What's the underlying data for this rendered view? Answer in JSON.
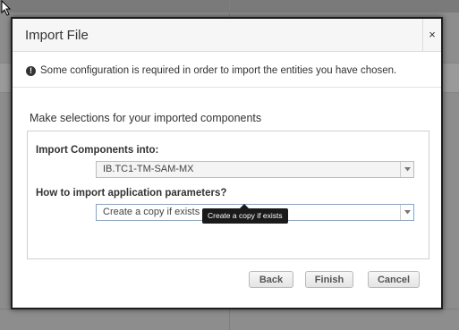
{
  "dialog": {
    "title": "Import File",
    "close_label": "×",
    "info_icon": "!",
    "info_text": "Some configuration is required in order to import the entities you have chosen.",
    "section_title": "Make selections for your imported components",
    "fields": {
      "components_label": "Import Components into:",
      "components_value": "IB.TC1-TM-SAM-MX",
      "params_label": "How to import application parameters?",
      "params_value": "Create a copy if exists"
    },
    "tooltip": "Create a copy if exists",
    "buttons": {
      "back": "Back",
      "finish": "Finish",
      "cancel": "Cancel"
    }
  },
  "colors": {
    "overlay": "#8d8d8d",
    "modal_border": "#1d1d1d",
    "focus_border": "#7aa7d8",
    "tooltip_bg": "#1a1a1a"
  }
}
